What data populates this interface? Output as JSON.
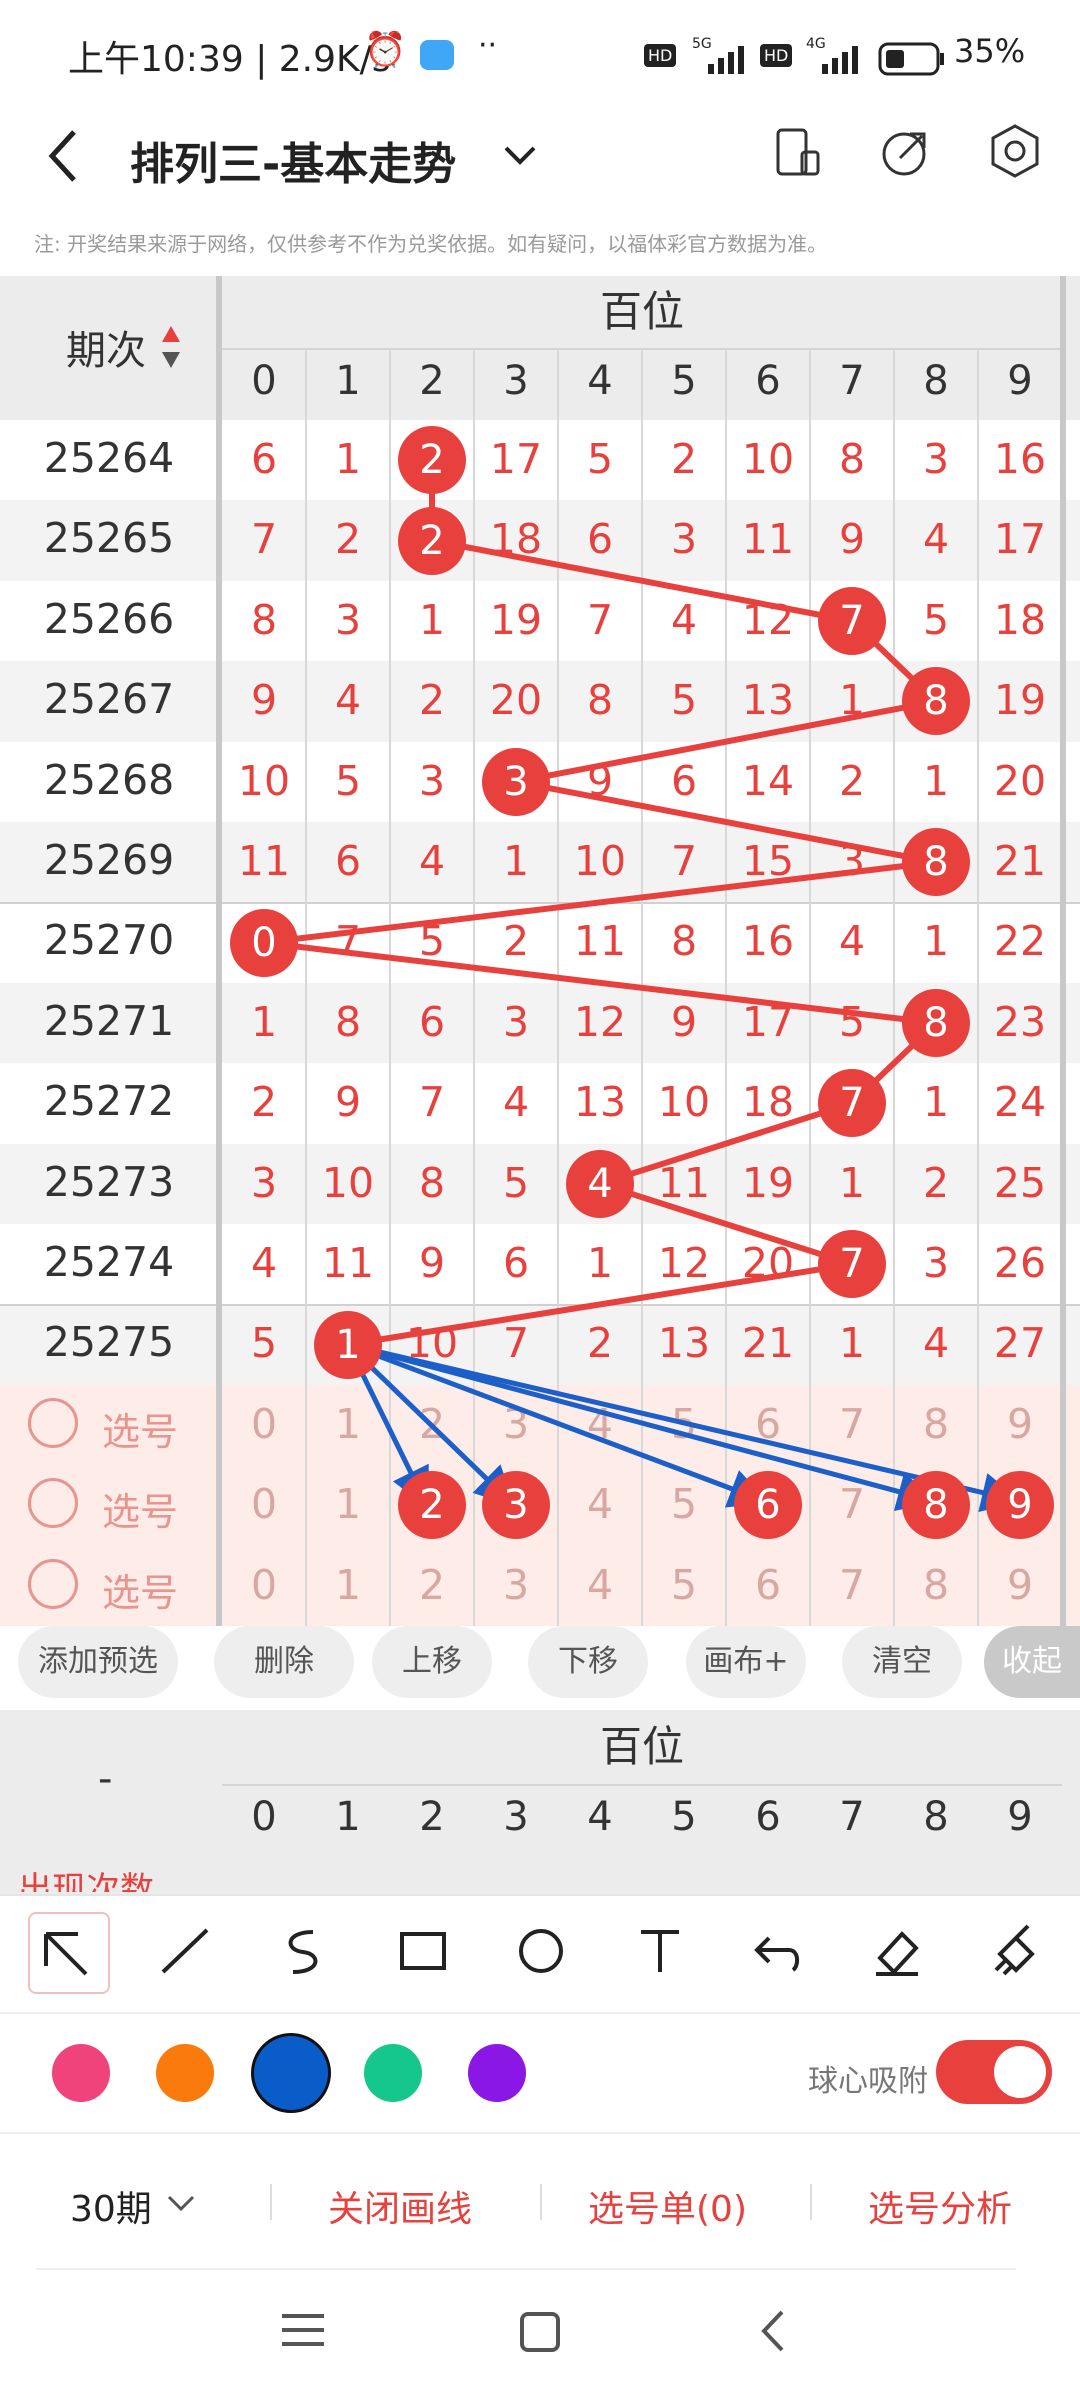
{
  "status_bar": {
    "time": "上午10:39 | 2.9K/s",
    "battery": "35%",
    "net1": "5G",
    "net2": "4G"
  },
  "appbar": {
    "title": "排列三-基本走势"
  },
  "note": "注: 开奖结果来源于网络，仅供参考不作为兑奖依据。如有疑问，以福体彩官方数据为准。",
  "grid": {
    "col_header_label": "期次",
    "group_label": "百位",
    "digits": [
      "0",
      "1",
      "2",
      "3",
      "4",
      "5",
      "6",
      "7",
      "8",
      "9"
    ],
    "rows": [
      {
        "issue": "25264",
        "cells": [
          "6",
          "1",
          "2",
          "17",
          "5",
          "2",
          "10",
          "8",
          "3",
          "16"
        ],
        "hit": 2
      },
      {
        "issue": "25265",
        "cells": [
          "7",
          "2",
          "2",
          "18",
          "6",
          "3",
          "11",
          "9",
          "4",
          "17"
        ],
        "hit": 2
      },
      {
        "issue": "25266",
        "cells": [
          "8",
          "3",
          "1",
          "19",
          "7",
          "4",
          "12",
          "7",
          "5",
          "18"
        ],
        "hit": 7
      },
      {
        "issue": "25267",
        "cells": [
          "9",
          "4",
          "2",
          "20",
          "8",
          "5",
          "13",
          "1",
          "8",
          "19"
        ],
        "hit": 8
      },
      {
        "issue": "25268",
        "cells": [
          "10",
          "5",
          "3",
          "3",
          "9",
          "6",
          "14",
          "2",
          "1",
          "20"
        ],
        "hit": 3
      },
      {
        "issue": "25269",
        "cells": [
          "11",
          "6",
          "4",
          "1",
          "10",
          "7",
          "15",
          "3",
          "8",
          "21"
        ],
        "hit": 8
      },
      {
        "issue": "25270",
        "cells": [
          "0",
          "7",
          "5",
          "2",
          "11",
          "8",
          "16",
          "4",
          "1",
          "22"
        ],
        "hit": 0
      },
      {
        "issue": "25271",
        "cells": [
          "1",
          "8",
          "6",
          "3",
          "12",
          "9",
          "17",
          "5",
          "8",
          "23"
        ],
        "hit": 8
      },
      {
        "issue": "25272",
        "cells": [
          "2",
          "9",
          "7",
          "4",
          "13",
          "10",
          "18",
          "7",
          "1",
          "24"
        ],
        "hit": 7
      },
      {
        "issue": "25273",
        "cells": [
          "3",
          "10",
          "8",
          "5",
          "4",
          "11",
          "19",
          "1",
          "2",
          "25"
        ],
        "hit": 4
      },
      {
        "issue": "25274",
        "cells": [
          "4",
          "11",
          "9",
          "6",
          "1",
          "12",
          "20",
          "7",
          "3",
          "26"
        ],
        "hit": 7
      },
      {
        "issue": "25275",
        "cells": [
          "5",
          "1",
          "10",
          "7",
          "2",
          "13",
          "21",
          "1",
          "4",
          "27"
        ],
        "hit": 1
      }
    ],
    "pick_label": "选号",
    "pick_rows": [
      {
        "cells": [
          "0",
          "1",
          "2",
          "3",
          "4",
          "5",
          "6",
          "7",
          "8",
          "9"
        ],
        "selected": []
      },
      {
        "cells": [
          "0",
          "1",
          "2",
          "3",
          "4",
          "5",
          "6",
          "7",
          "8",
          "9"
        ],
        "selected": [
          2,
          3,
          6,
          8,
          9
        ]
      },
      {
        "cells": [
          "0",
          "1",
          "2",
          "3",
          "4",
          "5",
          "6",
          "7",
          "8",
          "9"
        ],
        "selected": []
      }
    ]
  },
  "actions": [
    "添加预选",
    "删除",
    "上移",
    "下移",
    "画布+",
    "清空",
    "收起"
  ],
  "stats": {
    "left_label": "-",
    "group_label": "百位",
    "digits": [
      "0",
      "1",
      "2",
      "3",
      "4",
      "5",
      "6",
      "7",
      "8",
      "9"
    ],
    "row_label": "出现次数"
  },
  "tools": [
    "pointer-icon",
    "line-icon",
    "curve-icon",
    "rectangle-icon",
    "circle-icon",
    "text-icon",
    "undo-icon",
    "eraser-icon",
    "clear-icon"
  ],
  "colors": {
    "accent": "#e8413d",
    "pink": "#f0437c",
    "orange": "#fb7a0c",
    "blue": "#0a5cc8",
    "green": "#16c78d",
    "purple": "#8a17e6",
    "arrow": "#1c5fc9"
  },
  "snap": {
    "label": "球心吸附",
    "on": true
  },
  "bottom": {
    "period": "30期",
    "close_lines": "关闭画线",
    "pick_list": "选号单(0)",
    "analysis": "选号分析"
  }
}
